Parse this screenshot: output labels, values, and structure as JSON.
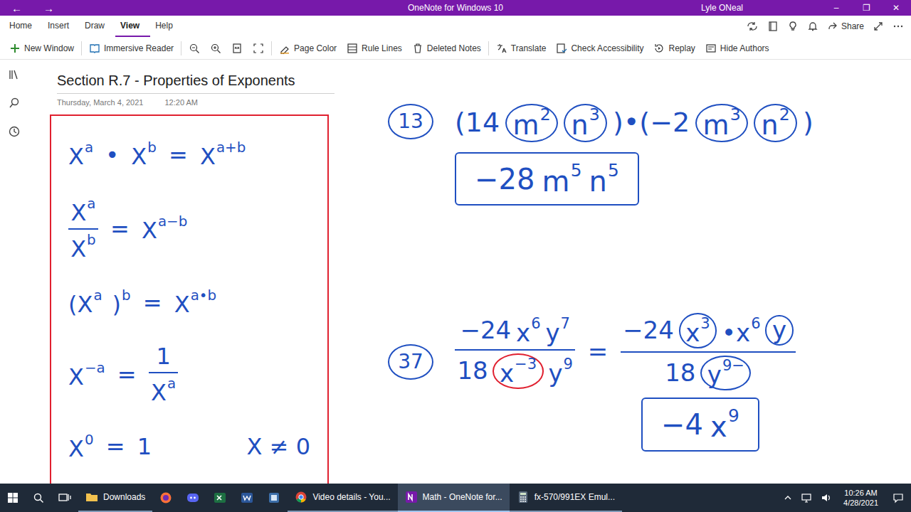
{
  "window": {
    "back": "←",
    "forward": "→",
    "title": "OneNote for Windows 10",
    "user": "Lyle ONeal",
    "controls": [
      "–",
      "❐",
      "✕"
    ]
  },
  "menu": [
    {
      "label": "Home",
      "selected": false
    },
    {
      "label": "Insert",
      "selected": false
    },
    {
      "label": "Draw",
      "selected": false
    },
    {
      "label": "View",
      "selected": true
    },
    {
      "label": "Help",
      "selected": false
    }
  ],
  "share": "Share",
  "ribbon": [
    "New Window",
    "Immersive Reader",
    "Page Color",
    "Rule Lines",
    "Deleted Notes",
    "Translate",
    "Check Accessibility",
    "Replay",
    "Hide Authors"
  ],
  "page": {
    "title": "Section R.7 - Properties of Exponents",
    "date": "Thursday, March 4, 2021",
    "time": "12:20 AM"
  },
  "rules": [
    {
      "parts": [
        {
          "kind": "term",
          "text": "X",
          "sup": "a"
        },
        {
          "kind": "op",
          "text": "•"
        },
        {
          "kind": "term",
          "text": "X",
          "sup": "b"
        },
        {
          "kind": "op",
          "text": "="
        },
        {
          "kind": "term",
          "text": "X",
          "sup": "a+b"
        }
      ]
    },
    {
      "parts": [
        {
          "kind": "frac",
          "num": [
            {
              "text": "X",
              "sup": "a"
            }
          ],
          "den": [
            {
              "text": "X",
              "sup": "b"
            }
          ]
        },
        {
          "kind": "op",
          "text": "="
        },
        {
          "kind": "term",
          "text": "X",
          "sup": "a−b"
        }
      ]
    },
    {
      "parts": [
        {
          "kind": "term",
          "text": "(X",
          "sup": "a"
        },
        {
          "kind": "term",
          "text": ")",
          "sup": "b"
        },
        {
          "kind": "op",
          "text": "="
        },
        {
          "kind": "term",
          "text": "X",
          "sup": "a•b"
        }
      ]
    },
    {
      "parts": [
        {
          "kind": "term",
          "text": "X",
          "sup": "−a"
        },
        {
          "kind": "op",
          "text": "="
        },
        {
          "kind": "frac",
          "num": [
            {
              "text": "1"
            }
          ],
          "den": [
            {
              "text": "X",
              "sup": "a"
            }
          ]
        }
      ]
    },
    {
      "parts": [
        {
          "kind": "term",
          "text": "X",
          "sup": "0"
        },
        {
          "kind": "op",
          "text": "="
        },
        {
          "kind": "term",
          "text": "1"
        },
        {
          "kind": "note",
          "text": "X ≠ 0"
        }
      ]
    }
  ],
  "problems": [
    {
      "number": "13",
      "expression": [
        {
          "kind": "term",
          "text": "(14",
          "circled": false
        },
        {
          "kind": "term",
          "text": "m",
          "sup": "2",
          "circled": true,
          "color": "#1f4fc1"
        },
        {
          "kind": "term",
          "text": "n",
          "sup": "3",
          "circled": true,
          "color": "#1f4fc1"
        },
        {
          "kind": "term",
          "text": ")•(−2",
          "circled": false
        },
        {
          "kind": "term",
          "text": "m",
          "sup": "3",
          "circled": true,
          "color": "#1f4fc1"
        },
        {
          "kind": "term",
          "text": "n",
          "sup": "2",
          "circled": true,
          "color": "#1f4fc1"
        },
        {
          "kind": "term",
          "text": ")",
          "circled": false
        }
      ],
      "answer": [
        {
          "kind": "term",
          "text": "−28",
          "circled": false
        },
        {
          "kind": "term",
          "text": "m",
          "sup": "5",
          "circled": false
        },
        {
          "kind": "term",
          "text": "n",
          "sup": "5",
          "circled": false
        }
      ]
    },
    {
      "number": "37",
      "expression": [
        {
          "kind": "frac",
          "num": [
            {
              "text": "−24",
              "circled": false
            },
            {
              "text": "x",
              "sup": "6",
              "circled": false
            },
            {
              "text": "y",
              "sup": "7",
              "circled": false
            }
          ],
          "den": [
            {
              "text": "18",
              "circled": false
            },
            {
              "text": "x",
              "sup": "−3",
              "circled": true,
              "color": "#e0202f"
            },
            {
              "text": "y",
              "sup": "9",
              "circled": false
            }
          ]
        },
        {
          "kind": "op",
          "text": "="
        },
        {
          "kind": "frac",
          "num": [
            {
              "text": "−24",
              "circled": false
            },
            {
              "text": "x",
              "sup": "3",
              "circled": true,
              "color": "#1f4fc1"
            },
            {
              "text": "•x",
              "sup": "6",
              "circled": false
            },
            {
              "text": "y",
              "circled": true,
              "color": "#1f4fc1"
            }
          ],
          "den": [
            {
              "text": "18",
              "circled": false
            },
            {
              "text": "y",
              "sup": "9−",
              "circled": true,
              "color": "#1f4fc1"
            }
          ]
        }
      ],
      "answer": [
        {
          "kind": "term",
          "text": "−4",
          "circled": false
        },
        {
          "kind": "term",
          "text": "x",
          "sup": "9",
          "circled": false
        }
      ]
    }
  ],
  "taskbar": {
    "apps": [
      {
        "kind": "labeled",
        "label": "Downloads",
        "selected": false
      },
      {
        "kind": "icon",
        "selected": false
      },
      {
        "kind": "icon",
        "selected": false
      },
      {
        "kind": "icon",
        "selected": false
      },
      {
        "kind": "icon",
        "selected": false
      },
      {
        "kind": "icon",
        "selected": false
      },
      {
        "kind": "labeled",
        "label": "Video details - You...",
        "selected": false
      },
      {
        "kind": "labeled",
        "label": "Math - OneNote for...",
        "selected": true
      },
      {
        "kind": "labeled",
        "label": "fx-570/991EX Emul...",
        "selected": false
      }
    ],
    "time": "10:26 AM",
    "date": "4/28/2021"
  }
}
